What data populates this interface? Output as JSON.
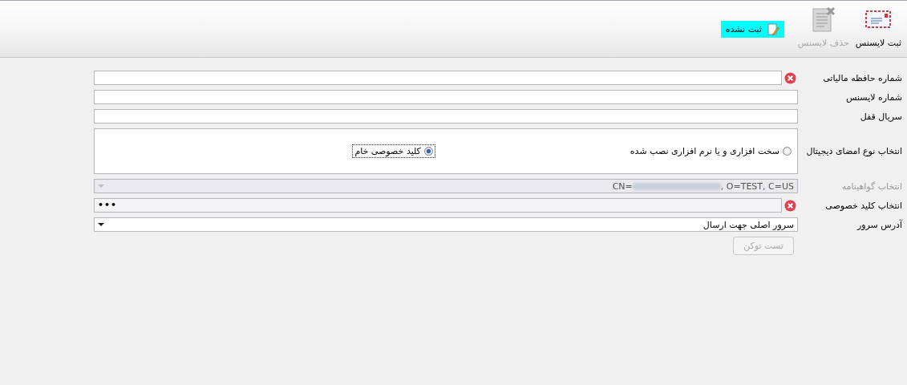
{
  "toolbar": {
    "buttons": [
      {
        "label": "ثبت لایسنس",
        "disabled": false
      },
      {
        "label": "حذف لایسنس",
        "disabled": true
      }
    ],
    "status_badge": {
      "label": "ثبت نشده"
    }
  },
  "form": {
    "fields": [
      {
        "kind": "text",
        "label": "شماره حافظه مالیاتی",
        "error": true,
        "disabled": false
      },
      {
        "kind": "text",
        "label": "شماره لایسنس",
        "error": false,
        "disabled": false
      },
      {
        "kind": "text",
        "label": "سریال قفل",
        "error": false,
        "disabled": false
      },
      {
        "kind": "radio_group",
        "label": "انتخاب نوع امضای دیجیتال",
        "options": [
          {
            "label": "سخت افزاری و یا نرم افزاری نصب شده",
            "selected": false
          },
          {
            "label": "کلید خصوصی خام",
            "selected": true
          }
        ],
        "error": false,
        "disabled": false
      },
      {
        "kind": "combo",
        "label": "انتخاب گواهینامه",
        "value_prefix": "CN=",
        "value_redacted": true,
        "value": ", O=TEST, C=US",
        "error": false,
        "disabled": true
      },
      {
        "kind": "password",
        "label": "انتخاب کلید خصوصی",
        "value": "•••",
        "error": true,
        "disabled": false
      },
      {
        "kind": "combo",
        "label": "آدرس سرور",
        "value": "سرور اصلی جهت ارسال",
        "error": false,
        "disabled": false
      }
    ],
    "button": {
      "label": "تست توکن",
      "disabled": true
    }
  }
}
